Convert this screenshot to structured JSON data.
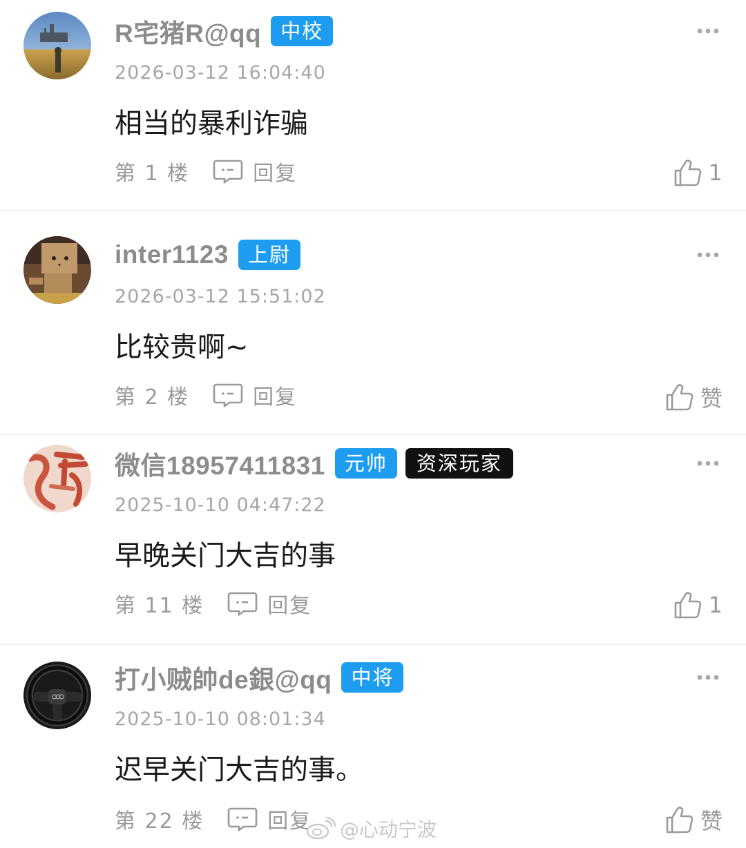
{
  "comments": [
    {
      "username": "R宅猪R@qq",
      "badges": [
        "中校"
      ],
      "timestamp": "2026-03-12 16:04:40",
      "content": "相当的暴利诈骗",
      "floor": "第 1 楼",
      "reply_label": "回复",
      "like": "1"
    },
    {
      "username": "inter1123",
      "badges": [
        "上尉"
      ],
      "timestamp": "2026-03-12 15:51:02",
      "content": "比较贵啊~",
      "floor": "第 2 楼",
      "reply_label": "回复",
      "like": "赞"
    },
    {
      "username": "微信18957411831",
      "badges": [
        "元帅",
        "资深玩家"
      ],
      "timestamp": "2025-10-10 04:47:22",
      "content": "早晚关门大吉的事",
      "floor": "第 11 楼",
      "reply_label": "回复",
      "like": "1"
    },
    {
      "username": "打小贼帥de銀@qq",
      "badges": [
        "中将"
      ],
      "timestamp": "2025-10-10 08:01:34",
      "content": "迟早关门大吉的事。",
      "floor": "第 22 楼",
      "reply_label": "回复",
      "like": "赞"
    }
  ],
  "watermark": "@心动宁波",
  "colors": {
    "badge_blue": "#1e9df0",
    "badge_dark": "#111111",
    "username_gray": "#8c8c8c",
    "meta_gray": "#9a9a9a"
  },
  "icons": {
    "reply": "comment-bubble-icon",
    "like": "thumbs-up-icon",
    "more": "more-dots-icon",
    "watermark": "weibo-logo-icon"
  }
}
